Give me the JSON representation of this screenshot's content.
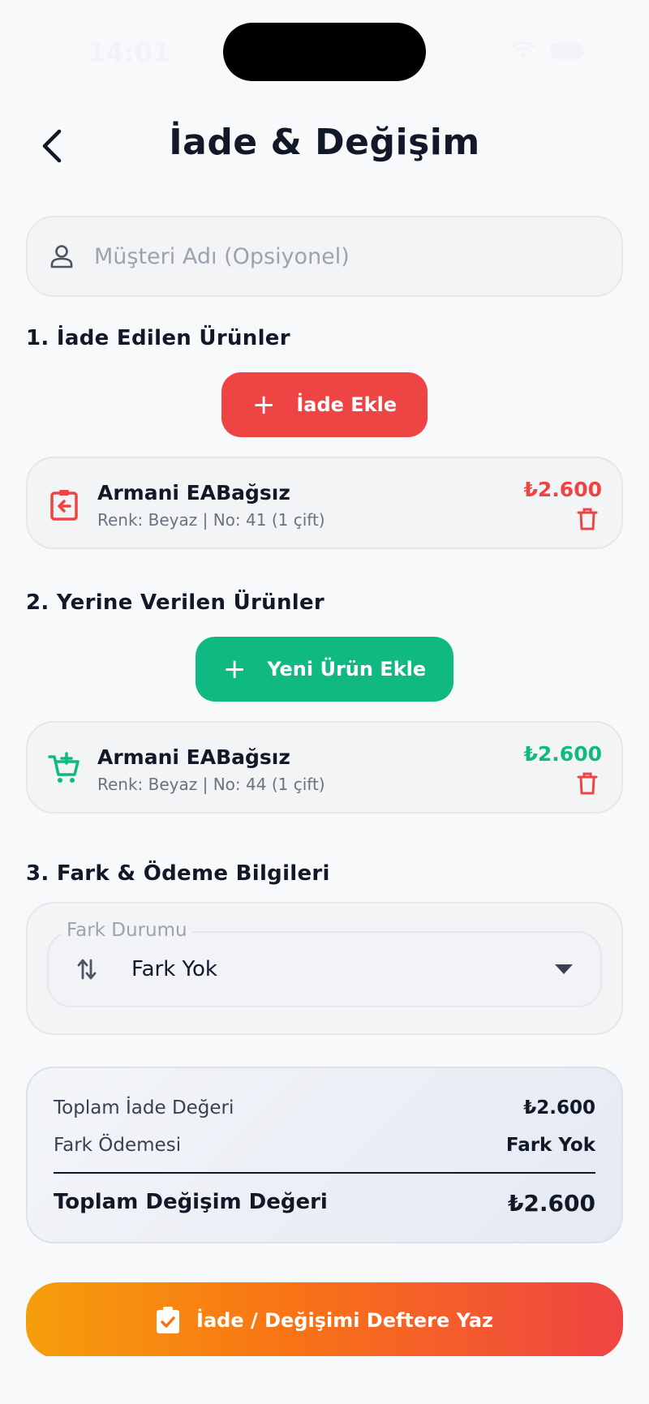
{
  "status_bar": {
    "time": "14:01"
  },
  "header": {
    "title": "İade & Değişim"
  },
  "customer": {
    "placeholder": "Müşteri Adı (Opsiyonel)",
    "value": ""
  },
  "returns": {
    "section_title": "1. İade Edilen Ürünler",
    "add_label": "İade Ekle",
    "items": [
      {
        "name": "Armani EABağsız",
        "detail": "Renk: Beyaz | No: 41 (1 çift)",
        "price": "₺2.600"
      }
    ]
  },
  "replacements": {
    "section_title": "2. Yerine Verilen Ürünler",
    "add_label": "Yeni Ürün Ekle",
    "items": [
      {
        "name": "Armani EABağsız",
        "detail": "Renk: Beyaz | No: 44 (1 çift)",
        "price": "₺2.600"
      }
    ]
  },
  "difference": {
    "section_title": "3. Fark & Ödeme Bilgileri",
    "field_label": "Fark Durumu",
    "selected": "Fark Yok"
  },
  "summary": {
    "total_return_label": "Toplam İade Değeri",
    "total_return_value": "₺2.600",
    "diff_payment_label": "Fark Ödemesi",
    "diff_payment_value": "Fark Yok",
    "total_exchange_label": "Toplam Değişim Değeri",
    "total_exchange_value": "₺2.600"
  },
  "submit": {
    "label": "İade / Değişimi Deftere Yaz"
  },
  "colors": {
    "return_accent": "#ef4444",
    "new_accent": "#10b981",
    "submit_gradient": [
      "#f59e0b",
      "#ef4444"
    ]
  }
}
